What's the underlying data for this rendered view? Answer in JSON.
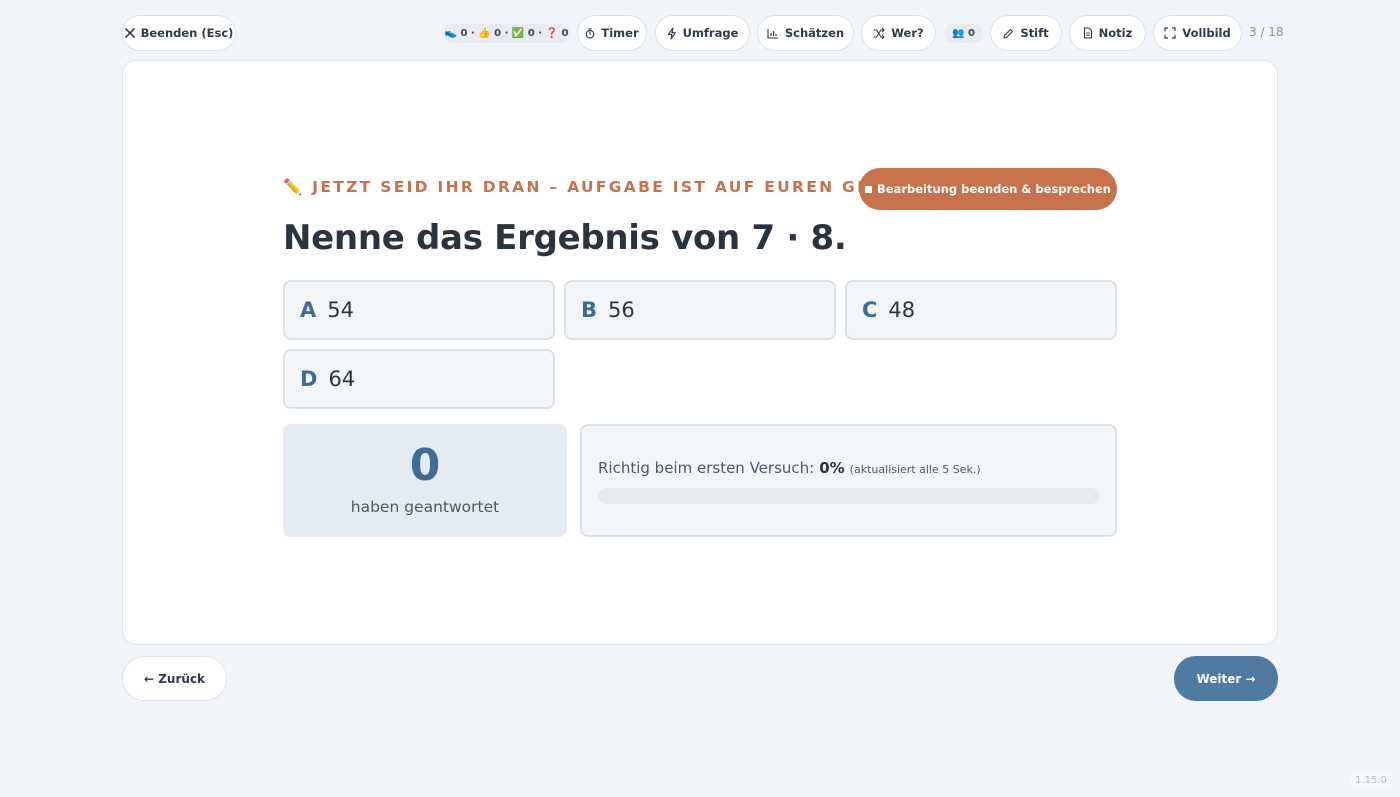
{
  "toolbar": {
    "exit_label": "Beenden (Esc)",
    "stats": {
      "shoe_count": "0",
      "thumbs_count": "0",
      "check_count": "0",
      "question_count": "0"
    },
    "timer_label": "Timer",
    "poll_label": "Umfrage",
    "estimate_label": "Schätzen",
    "who_label": "Wer?",
    "participants_count": "0",
    "pen_label": "Stift",
    "note_label": "Notiz",
    "fullscreen_label": "Vollbild",
    "slide_counter": "3 / 18"
  },
  "slide": {
    "kicker": "✏️ JETZT SEID IHR DRAN – AUFGABE IST AUF EUREN GERÄTEN",
    "stop_button_label": "Bearbeitung beenden & besprechen",
    "question": "Nenne das Ergebnis von 7 · 8.",
    "options": [
      {
        "letter": "A",
        "value": "54"
      },
      {
        "letter": "B",
        "value": "56"
      },
      {
        "letter": "C",
        "value": "48"
      },
      {
        "letter": "D",
        "value": "64"
      }
    ],
    "answered_count": "0",
    "answered_label": "haben geantwortet",
    "first_try_label": "Richtig beim ersten Versuch:",
    "first_try_percent": "0%",
    "first_try_fraction": 0,
    "update_note": "(aktualisiert alle 5 Sek.)"
  },
  "nav": {
    "back_label": "← Zurück",
    "next_label": "Weiter →"
  },
  "version": "1.15.0",
  "colors": {
    "accent_orange": "#c8714d",
    "accent_blue": "#3d6c95",
    "next_button": "#4f7ba3",
    "background": "#f1f4f8"
  }
}
